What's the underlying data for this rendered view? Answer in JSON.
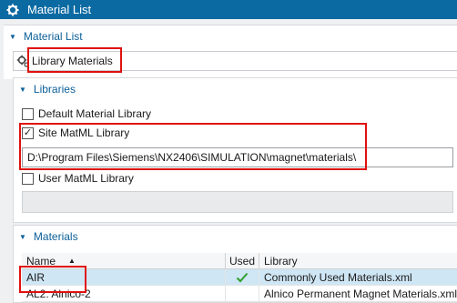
{
  "window": {
    "title": "Material List",
    "icon": "gear-icon"
  },
  "material_list_group": {
    "header": "Material List",
    "selector_label": "Library Materials",
    "selector_icon": "cog-icon"
  },
  "libraries_group": {
    "header": "Libraries",
    "default_library": {
      "label": "Default Material Library",
      "checked": false
    },
    "site_library": {
      "label": "Site MatML Library",
      "checked": true,
      "path": "D:\\Program Files\\Siemens\\NX2406\\SIMULATION\\magnet\\materials\\"
    },
    "user_library": {
      "label": "User MatML Library",
      "checked": false,
      "path": ""
    }
  },
  "materials_group": {
    "header": "Materials",
    "columns": {
      "name": "Name",
      "used": "Used",
      "library": "Library"
    },
    "rows": [
      {
        "name": "AIR",
        "used": "✓",
        "library": "Commonly Used Materials.xml"
      },
      {
        "name": "AL2: Alnico-2",
        "used": "",
        "library": "Alnico Permanent Magnet Materials.xml"
      }
    ]
  },
  "colors": {
    "titlebar": "#0b6aa2",
    "accent": "#0a5f99",
    "highlight": "#e01010",
    "selected_row": "#cfe6f4",
    "check": "#2e9e2e"
  }
}
